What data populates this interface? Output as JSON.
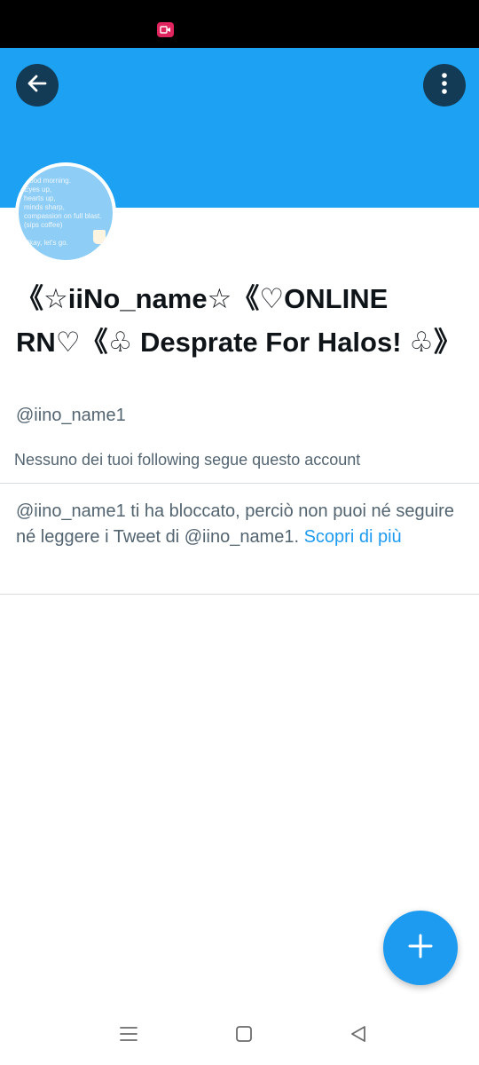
{
  "status_bar": {
    "recording_icon": "screen-record-icon"
  },
  "header": {
    "back_icon": "arrow-left-icon",
    "more_icon": "vertical-dots-icon",
    "banner_color": "#1da1f2"
  },
  "profile": {
    "avatar_text": [
      "Good morning.",
      "Eyes up,",
      "hearts up,",
      "minds sharp,",
      "compassion on full blast.",
      "(sips coffee)",
      "",
      "Okay, let's go."
    ],
    "display_name": "《☆iiNo_name☆《♡ONLINE RN♡《♧ Desprate For Halos! ♧》",
    "handle": "@iino_name1",
    "followers_note": "Nessuno dei tuoi following segue questo account"
  },
  "blocked_notice": {
    "text": "@iino_name1 ti ha bloccato, perciò non puoi né seguire né leggere i Tweet di @iino_name1.",
    "link_label": "Scopri di più"
  },
  "fab": {
    "icon": "plus-icon",
    "color": "#1d9bf0"
  },
  "nav": {
    "menu_icon": "recent-apps-icon",
    "home_icon": "home-square-icon",
    "back_icon": "back-triangle-icon"
  },
  "colors": {
    "accent": "#1d9bf0",
    "text_primary": "#0f1419",
    "text_secondary": "#536471"
  }
}
